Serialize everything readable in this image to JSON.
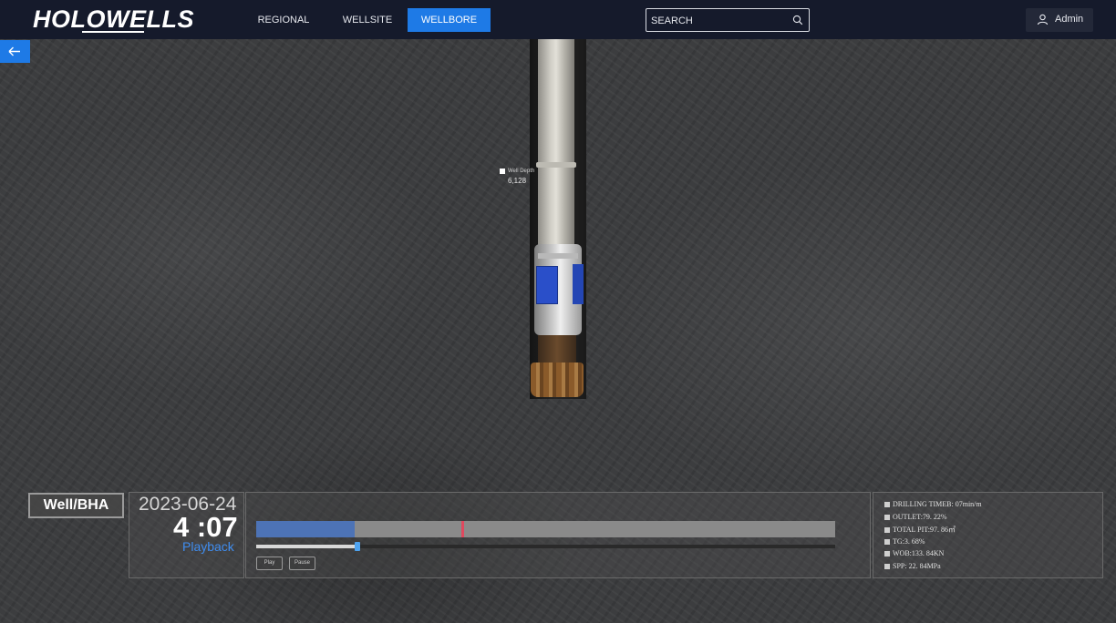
{
  "header": {
    "logo": "HOLOWELLS",
    "nav": [
      {
        "label": "REGIONAL",
        "active": false
      },
      {
        "label": "WELLSITE",
        "active": false
      },
      {
        "label": "WELLBORE",
        "active": true
      }
    ],
    "search": {
      "placeholder": "SEARCH",
      "icon": "search-icon"
    },
    "user": {
      "label": "Admin",
      "icon": "user-icon"
    }
  },
  "back_button": {
    "icon": "arrow-left-icon"
  },
  "wellbore": {
    "depth_label": "Well Depth",
    "depth_value": "6,128"
  },
  "panel": {
    "tag": "Well/BHA",
    "date": "2023-06-24",
    "time": "4 :07",
    "mode": "Playback",
    "play_label": "Play",
    "pause_label": "Pause",
    "progress_fraction": 0.17,
    "marker_fraction": 0.355,
    "slider_fraction": 0.175
  },
  "metrics": [
    "DRILLING TIMEB: 07min/m",
    "OUTLET:79. 22%",
    "TOTAL PIT:97. 86㎥",
    "TG:3. 68%",
    "WOB:133. 84KN",
    "SPP: 22. 84MPa"
  ],
  "colors": {
    "accent": "#1e7ae6",
    "header_bg": "#151a2b",
    "progress": "#4d73b6",
    "marker": "#e0485e"
  }
}
